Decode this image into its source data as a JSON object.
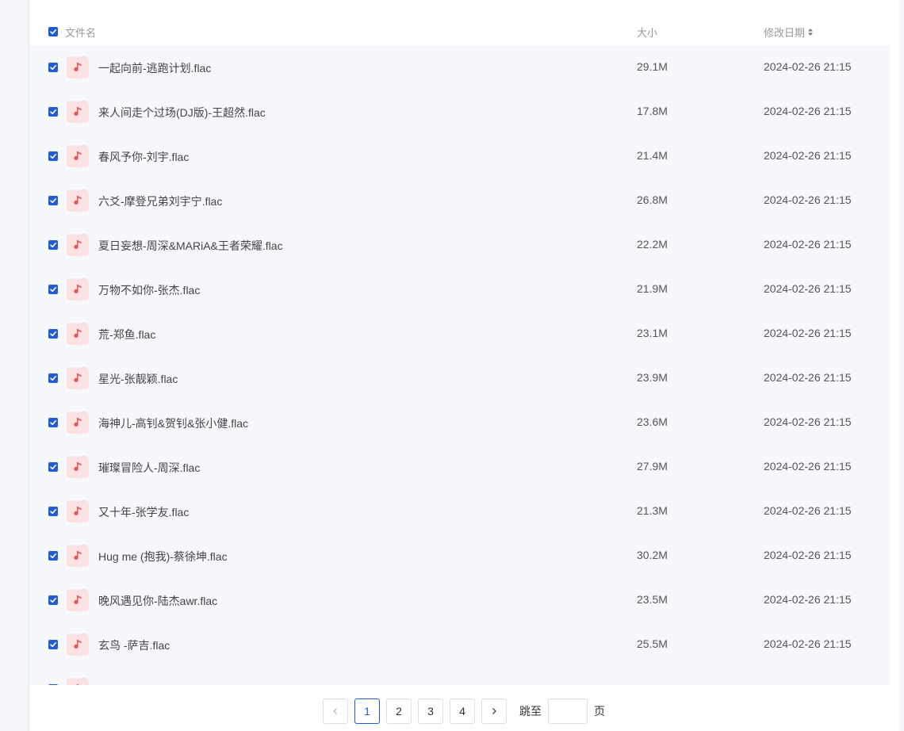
{
  "table": {
    "header": {
      "name": "文件名",
      "size": "大小",
      "date": "修改日期"
    },
    "rows": [
      {
        "name": "一起向前-逃跑计划.flac",
        "size": "29.1M",
        "date": "2024-02-26 21:15"
      },
      {
        "name": "来人间走个过场(DJ版)-王超然.flac",
        "size": "17.8M",
        "date": "2024-02-26 21:15"
      },
      {
        "name": "春风予你-刘宇.flac",
        "size": "21.4M",
        "date": "2024-02-26 21:15"
      },
      {
        "name": "六爻-摩登兄弟刘宇宁.flac",
        "size": "26.8M",
        "date": "2024-02-26 21:15"
      },
      {
        "name": "夏日妄想-周深&MARiA&王者荣耀.flac",
        "size": "22.2M",
        "date": "2024-02-26 21:15"
      },
      {
        "name": "万物不如你-张杰.flac",
        "size": "21.9M",
        "date": "2024-02-26 21:15"
      },
      {
        "name": "荒-郑鱼.flac",
        "size": "23.1M",
        "date": "2024-02-26 21:15"
      },
      {
        "name": "星光-张靓颖.flac",
        "size": "23.9M",
        "date": "2024-02-26 21:15"
      },
      {
        "name": "海神儿-高钊&贺钊&张小健.flac",
        "size": "23.6M",
        "date": "2024-02-26 21:15"
      },
      {
        "name": "璀璨冒险人-周深.flac",
        "size": "27.9M",
        "date": "2024-02-26 21:15"
      },
      {
        "name": "又十年-张学友.flac",
        "size": "21.3M",
        "date": "2024-02-26 21:15"
      },
      {
        "name": "Hug me (抱我)-蔡徐坤.flac",
        "size": "30.2M",
        "date": "2024-02-26 21:15"
      },
      {
        "name": "晚风遇见你-陆杰awr.flac",
        "size": "23.5M",
        "date": "2024-02-26 21:15"
      },
      {
        "name": "玄鸟 -萨吉.flac",
        "size": "25.5M",
        "date": "2024-02-26 21:15"
      },
      {
        "name": "",
        "size": "",
        "date": ""
      }
    ]
  },
  "pagination": {
    "prev_icon": "chevron-left-icon",
    "next_icon": "chevron-right-icon",
    "pages": [
      "1",
      "2",
      "3",
      "4"
    ],
    "current": "1",
    "jump_label": "跳至",
    "jump_value": "",
    "page_unit": "页"
  },
  "colors": {
    "accent": "#1e5cd8",
    "row_bg": "#f6f8fe",
    "icon_bg": "#fde2e2",
    "icon_fg": "#f0505a"
  }
}
